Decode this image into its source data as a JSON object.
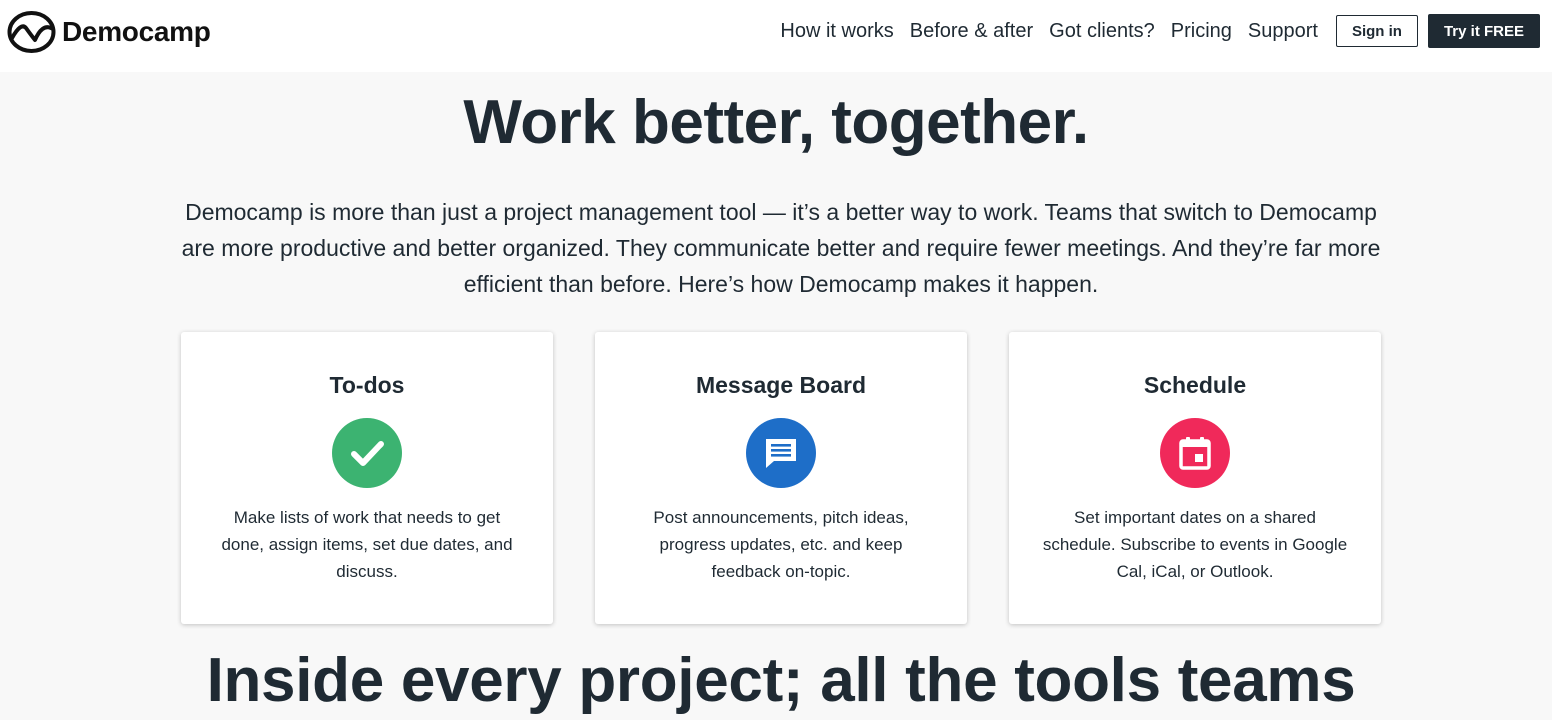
{
  "header": {
    "logo_text": "Democamp",
    "nav": [
      {
        "label": "How it works"
      },
      {
        "label": "Before & after"
      },
      {
        "label": "Got clients?"
      },
      {
        "label": "Pricing"
      },
      {
        "label": "Support"
      }
    ],
    "signin_label": "Sign in",
    "try_label": "Try it FREE"
  },
  "hero": {
    "title": "Work better, together.",
    "intro": "Democamp is more than just a project management tool — it’s a better way to work. Teams that switch to Democamp are more productive and better organized. They communicate better and require fewer meetings. And they’re far more efficient than before. Here’s how Democamp makes it happen."
  },
  "cards": [
    {
      "title": "To-dos",
      "icon": "checkmark-icon",
      "icon_color": "#3cb371",
      "description": "Make lists of work that needs to get done, assign items, set due dates, and discuss."
    },
    {
      "title": "Message Board",
      "icon": "message-icon",
      "icon_color": "#1e6ec8",
      "description": "Post announcements, pitch ideas, progress updates, etc. and keep feedback on-topic."
    },
    {
      "title": "Schedule",
      "icon": "calendar-icon",
      "icon_color": "#f0295a",
      "description": "Set important dates on a shared schedule. Subscribe to events in Google Cal, iCal, or Outlook."
    }
  ],
  "section": {
    "title": "Inside every project; all the tools teams"
  },
  "colors": {
    "text": "#1f2a33",
    "background": "#f8f8f8",
    "primary_button": "#1f2a33"
  }
}
